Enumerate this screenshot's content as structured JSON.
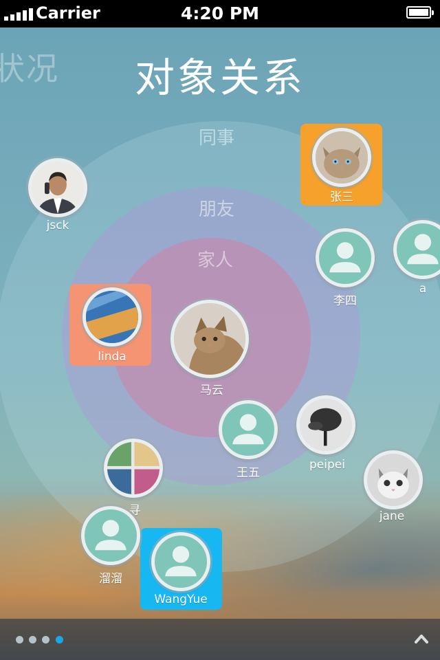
{
  "status_bar": {
    "carrier": "Carrier",
    "time": "4:20 PM"
  },
  "header": {
    "title": "对象关系",
    "previous_title_fragment": "状况"
  },
  "rings": {
    "colleague": "同事",
    "friend": "朋友",
    "family": "家人"
  },
  "contacts": {
    "center": "马云",
    "jsck": "jsck",
    "zhangsan": "张三",
    "lisi": "李四",
    "a": "a",
    "linda": "linda",
    "wangwu": "王五",
    "peipei": "peipei",
    "xun": "寻",
    "jane": "jane",
    "liuliu": "溜溜",
    "wangyue": "WangYue"
  },
  "pager": {
    "count": 4,
    "active_index": 3
  },
  "colors": {
    "accent": "#1aa6e8",
    "highlight_orange": "#f6a12c",
    "highlight_salmon": "#f59472",
    "highlight_blue": "#17b8f2",
    "avatar_teal": "#7fc5b8"
  }
}
